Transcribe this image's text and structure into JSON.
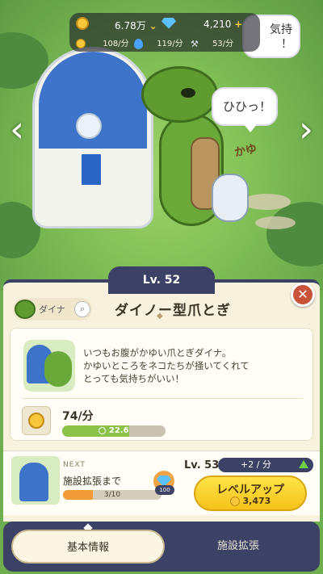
{
  "resources": {
    "coins": "6.78万",
    "gems": "4,210",
    "coin_rate": "108/分",
    "water_rate": "119/分",
    "tool_rate": "53/分"
  },
  "scene": {
    "bubble_1": "ひひっ！",
    "bubble_2": "気持\n！",
    "exclaim": "かゆ"
  },
  "panel": {
    "level": "Lv. 52",
    "chip_label": "ダイナ",
    "title": "ダイノー型爪とぎ",
    "ornament": "◆",
    "description": "いつもお腹がかゆい爪とぎダイナ。\nかゆいところをネコたちが掻いてくれて\nとっても気持ちがいい！",
    "rate": "74/分",
    "rate_timer": "22.6",
    "rate_progress": 0.65
  },
  "next": {
    "label": "NEXT",
    "title": "施設拡張まで",
    "progress_text": "3/10",
    "progress": 0.3,
    "gem_count": "100",
    "next_level": "Lv. 53",
    "rate_increase": "+2 / 分",
    "levelup_label": "レベルアップ",
    "levelup_cost": "3,473"
  },
  "tabs": {
    "basic": "基本情報",
    "expand": "施設拡張"
  },
  "colors": {
    "panel_navy": "#3c4166",
    "levelup_yellow": "#f5c21a",
    "close_red": "#c9523a"
  },
  "icons": {
    "coin": "coin-icon",
    "gem": "gem-icon",
    "water": "water-drop-icon",
    "tool": "wrench-icon",
    "close": "close-icon",
    "search": "search-icon"
  }
}
